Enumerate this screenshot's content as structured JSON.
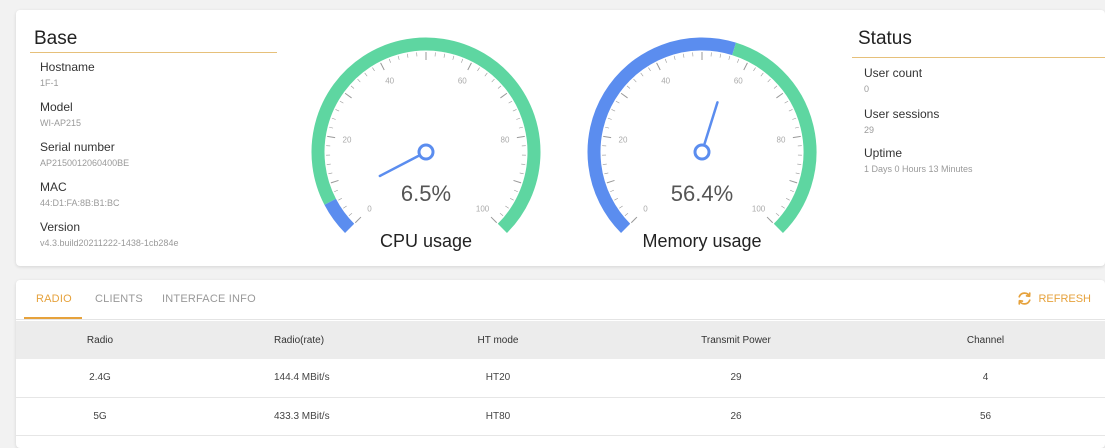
{
  "base": {
    "title": "Base",
    "hostname_label": "Hostname",
    "hostname": "1F-1",
    "model_label": "Model",
    "model": "WI-AP215",
    "serial_label": "Serial number",
    "serial": "AP2150012060400BE",
    "mac_label": "MAC",
    "mac": "44:D1:FA:8B:B1:BC",
    "version_label": "Version",
    "version": "v4.3.build20211222-1438-1cb284e"
  },
  "cpu": {
    "value_text": "6.5%",
    "value": 6.5,
    "label": "CPU usage"
  },
  "memory": {
    "value_text": "56.4%",
    "value": 56.4,
    "label": "Memory usage"
  },
  "gauge_ticks": [
    "0",
    "20",
    "40",
    "60",
    "80",
    "100"
  ],
  "colors": {
    "gauge_green": "#5ed6a1",
    "gauge_blue": "#5b8def",
    "accent": "#e6a23c"
  },
  "status": {
    "title": "Status",
    "user_count_label": "User count",
    "user_count": "0",
    "user_sessions_label": "User sessions",
    "user_sessions": "29",
    "uptime_label": "Uptime",
    "uptime": "1 Days 0 Hours 13 Minutes"
  },
  "tabs": {
    "radio": "RADIO",
    "clients": "CLIENTS",
    "interface": "INTERFACE INFO",
    "refresh": "REFRESH"
  },
  "table": {
    "headers": [
      "Radio",
      "Radio(rate)",
      "HT mode",
      "Transmit Power",
      "Channel"
    ],
    "rows": [
      [
        "2.4G",
        "144.4 MBit/s",
        "HT20",
        "29",
        "4"
      ],
      [
        "5G",
        "433.3 MBit/s",
        "HT80",
        "26",
        "56"
      ]
    ]
  }
}
